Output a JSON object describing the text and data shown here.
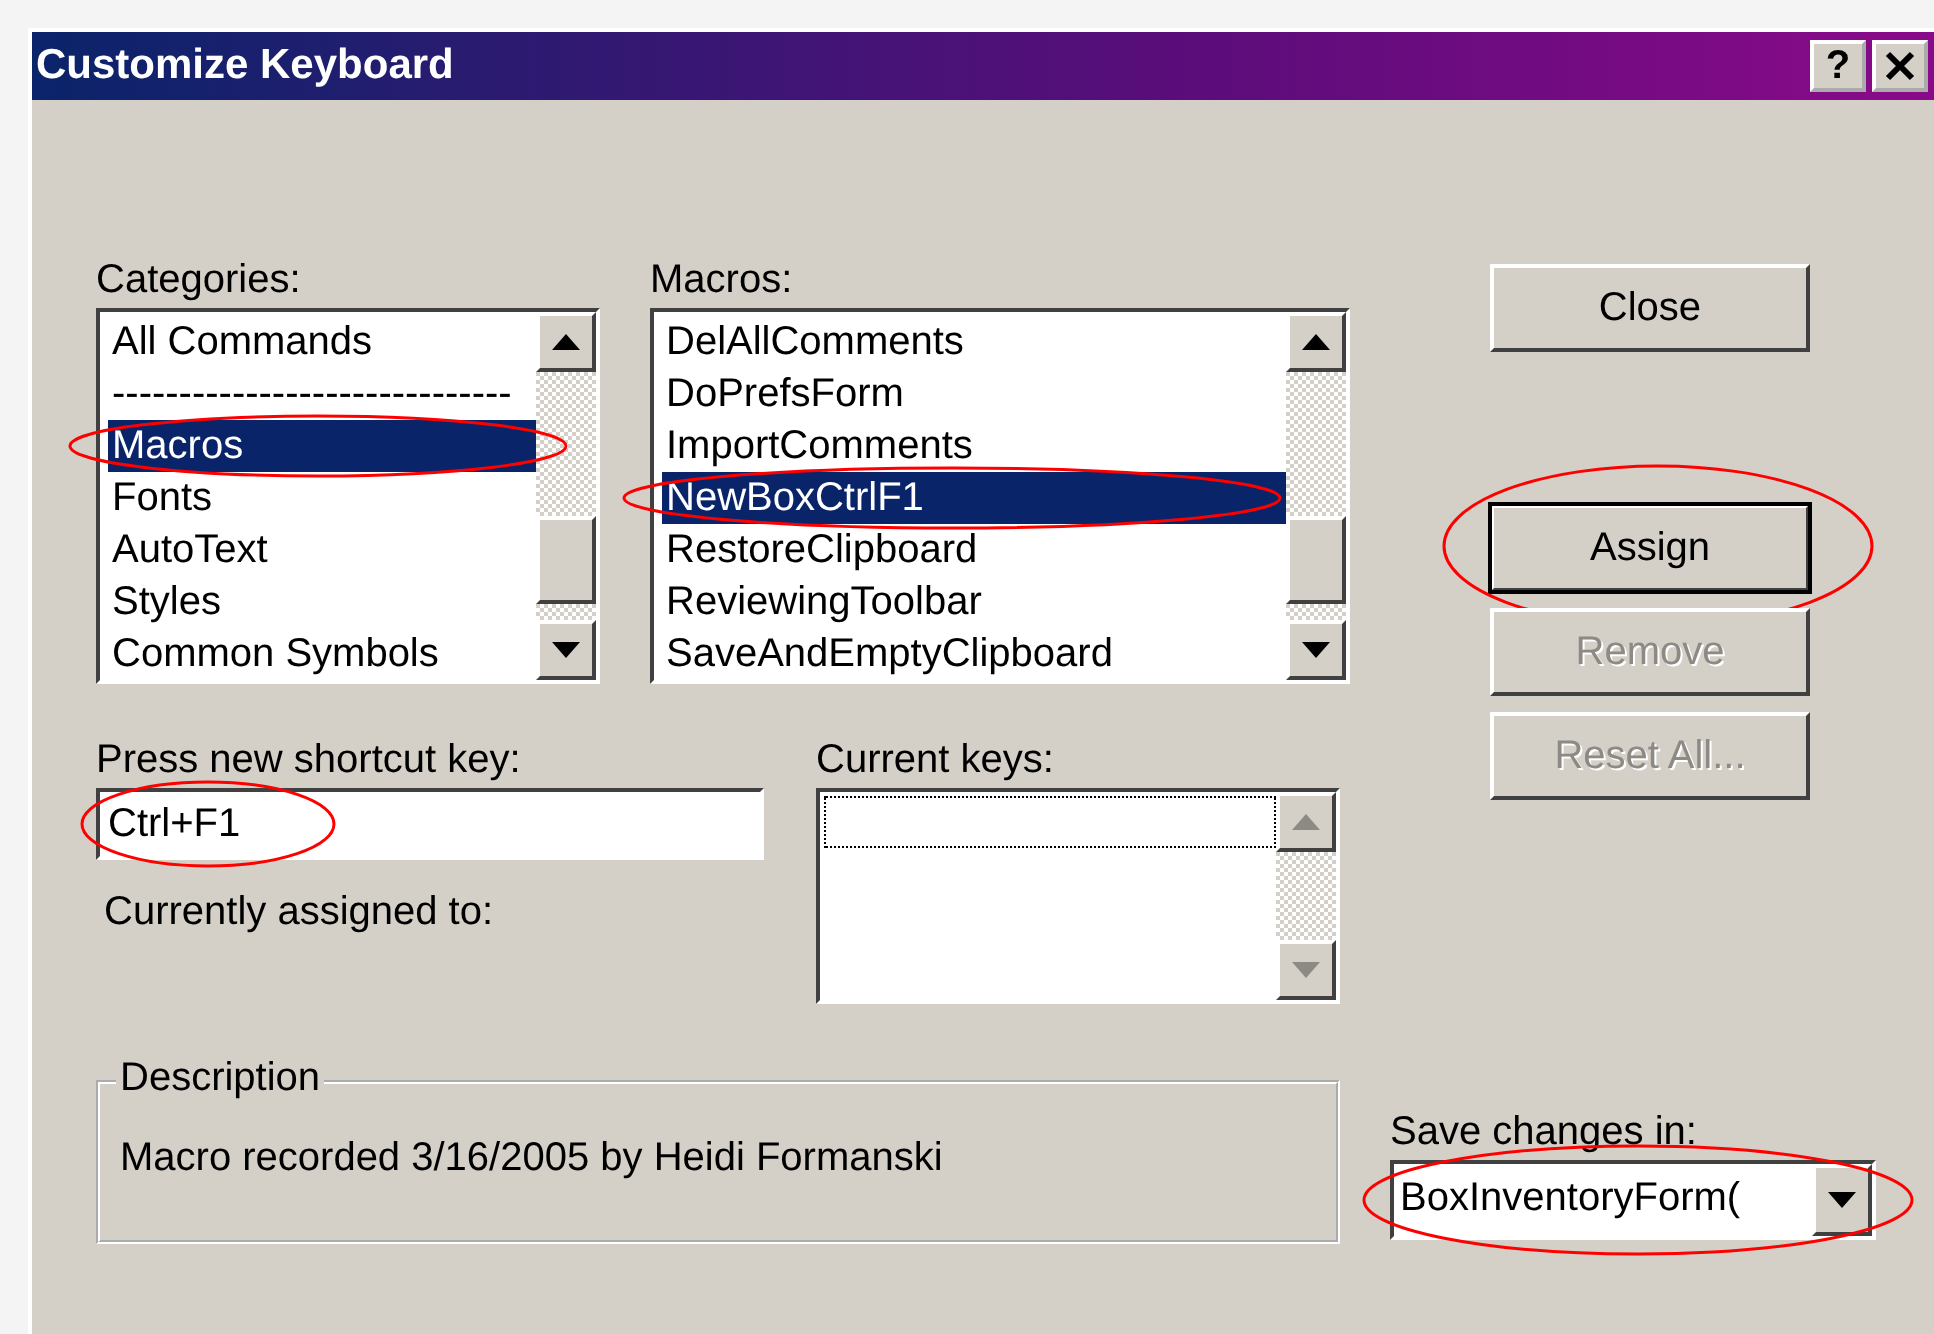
{
  "window": {
    "title": "Customize Keyboard",
    "help": "?"
  },
  "categories": {
    "label": "Categories:",
    "items": [
      {
        "text": "All Commands",
        "selected": false,
        "circled": false
      },
      {
        "text": "------------------------------",
        "selected": false,
        "circled": false
      },
      {
        "text": "Macros",
        "selected": true,
        "circled": true
      },
      {
        "text": "Fonts",
        "selected": false,
        "circled": false
      },
      {
        "text": "AutoText",
        "selected": false,
        "circled": false
      },
      {
        "text": "Styles",
        "selected": false,
        "circled": false
      },
      {
        "text": "Common Symbols",
        "selected": false,
        "circled": false
      }
    ]
  },
  "macros": {
    "label": "Macros:",
    "items": [
      {
        "text": "DelAllComments",
        "selected": false,
        "circled": false
      },
      {
        "text": "DoPrefsForm",
        "selected": false,
        "circled": false
      },
      {
        "text": "ImportComments",
        "selected": false,
        "circled": false
      },
      {
        "text": "NewBoxCtrlF1",
        "selected": true,
        "circled": true
      },
      {
        "text": "RestoreClipboard",
        "selected": false,
        "circled": false
      },
      {
        "text": "ReviewingToolbar",
        "selected": false,
        "circled": false
      },
      {
        "text": "SaveAndEmptyClipboard",
        "selected": false,
        "circled": false
      }
    ]
  },
  "buttons": [
    {
      "label": "Close",
      "default": false,
      "disabled": false,
      "circled": false
    },
    {
      "label": "Assign",
      "default": true,
      "disabled": false,
      "circled": true
    },
    {
      "label": "Remove",
      "default": false,
      "disabled": true,
      "circled": false
    },
    {
      "label": "Reset All...",
      "default": false,
      "disabled": true,
      "circled": false
    }
  ],
  "shortcut": {
    "label": "Press new shortcut key:",
    "value": "Ctrl+F1",
    "circled": true
  },
  "currently_assigned": {
    "label": "Currently assigned to:"
  },
  "current_keys": {
    "label": "Current keys:",
    "disabled": true
  },
  "description": {
    "legend": "Description",
    "text": "Macro recorded 3/16/2005 by Heidi Formanski"
  },
  "save_changes": {
    "label": "Save changes in:",
    "value": "BoxInventoryForm(",
    "circled": true
  }
}
